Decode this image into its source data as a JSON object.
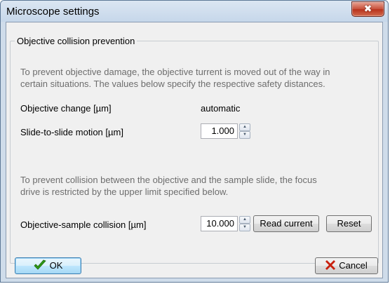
{
  "window": {
    "title": "Microscope settings",
    "close_symbol": "✖"
  },
  "group": {
    "title": "Objective collision prevention",
    "description_1": [
      "To prevent objective damage, the objective turrent is moved out of the way in",
      "certain situations. The values below specify the respective safety distances."
    ],
    "objective_change_label": "Objective change [µm]",
    "objective_change_value": "automatic",
    "slide_motion_label": "Slide-to-slide motion [µm]",
    "slide_motion_value": "1.000",
    "description_2": [
      "To prevent collision between the objective and the sample slide, the focus",
      "drive is restricted by the upper limit specified below."
    ],
    "sample_collision_label": "Objective-sample collision [µm]",
    "sample_collision_value": "10.000",
    "read_current_label": "Read current",
    "reset_label": "Reset"
  },
  "footer": {
    "ok_label": "OK",
    "cancel_label": "Cancel"
  },
  "icons": {
    "ok": "checkmark-icon",
    "cancel": "red-x-icon",
    "close": "close-icon",
    "spin_up": "arrow-up-icon",
    "spin_down": "arrow-down-icon"
  },
  "colors": {
    "ok_check": "#2e9a16",
    "cancel_x": "#c8200e",
    "close_button": "#c7503a"
  }
}
